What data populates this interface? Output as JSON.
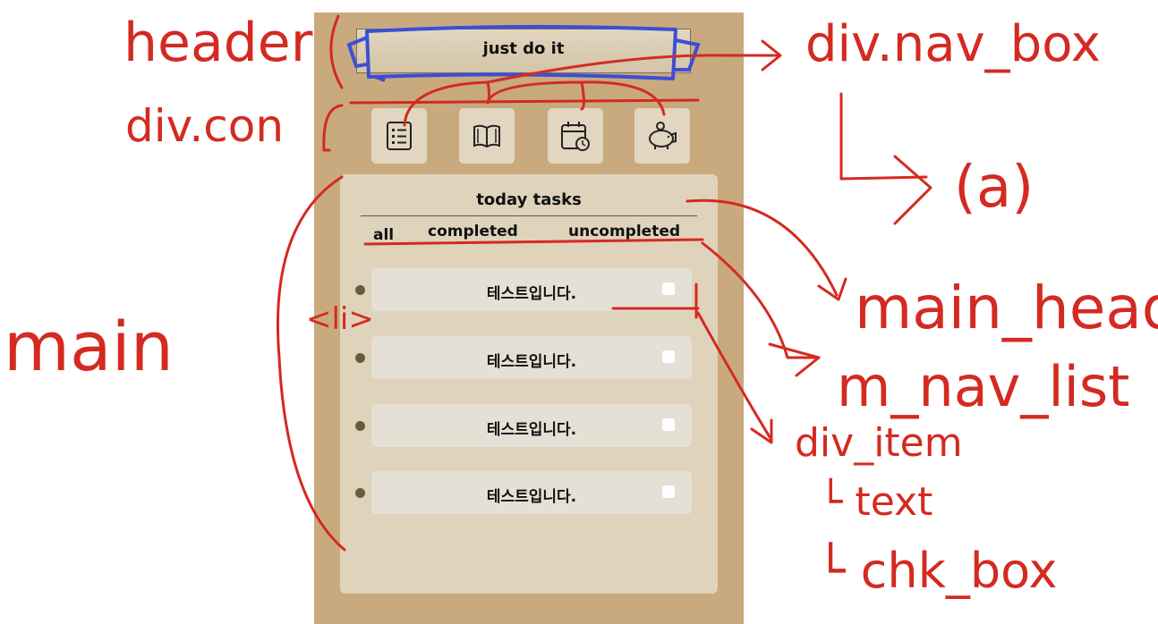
{
  "app": {
    "title": "just do it",
    "nav_icons": [
      "list-icon",
      "book-icon",
      "calendar-icon",
      "piggy-bank-icon"
    ],
    "colors": {
      "background": "#c8aa7e",
      "panel": "#dfd3bc",
      "item": "#e4e0d5",
      "bullet": "#6b5a3e"
    }
  },
  "main": {
    "title": "today tasks",
    "tabs": [
      "all",
      "completed",
      "uncompleted"
    ],
    "items": [
      {
        "text": "테스트입니다."
      },
      {
        "text": "테스트입니다."
      },
      {
        "text": "테스트입니다."
      },
      {
        "text": "테스트입니다."
      }
    ]
  },
  "annotations": {
    "header": "header",
    "div_con": "div.con",
    "nav_box": "div.nav_box",
    "a_tag": "(a)",
    "main": "main",
    "li": "<li>",
    "main_head": "main_head",
    "m_nav_list": "m_nav_list",
    "div_item": "div_item",
    "text": "└ text",
    "chk_box": "└ chk_box",
    "ink_color": "#d42a21",
    "box_color": "#3b4fd6"
  }
}
